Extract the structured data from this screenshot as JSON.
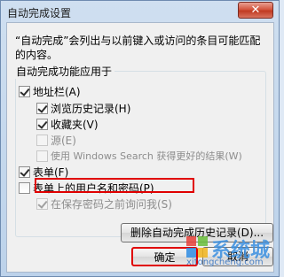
{
  "window": {
    "title": "自动完成设置",
    "close_glyph": "✕"
  },
  "description": "“自动完成”会列出与以前键入或访问的条目可能匹配的内容。",
  "group": {
    "title": "自动完成功能应用于",
    "items": [
      {
        "label": "地址栏(A)",
        "checked": true,
        "disabled": false
      },
      {
        "label": "浏览历史记录(H)",
        "checked": true,
        "disabled": false
      },
      {
        "label": "收藏夹(V)",
        "checked": true,
        "disabled": false
      },
      {
        "label": "源(E)",
        "checked": false,
        "disabled": true
      },
      {
        "label": "使用 Windows Search 获得更好的结果(W)",
        "checked": false,
        "disabled": true
      },
      {
        "label": "表单(F)",
        "checked": true,
        "disabled": false
      },
      {
        "label": "表单上的用户名和密码(P)",
        "checked": false,
        "disabled": false
      },
      {
        "label": "在保存密码之前询问我(S)",
        "checked": true,
        "disabled": true
      }
    ]
  },
  "buttons": {
    "delete_history": "删除自动完成历史记录(D)...",
    "ok": "确定",
    "cancel": "取消"
  },
  "watermark": {
    "brand": "系统城",
    "url": "xitongcheng.com"
  },
  "colors": {
    "highlight": "#e00000",
    "title_bg": "#cfdff0",
    "watermark": "#3a8fe0"
  }
}
